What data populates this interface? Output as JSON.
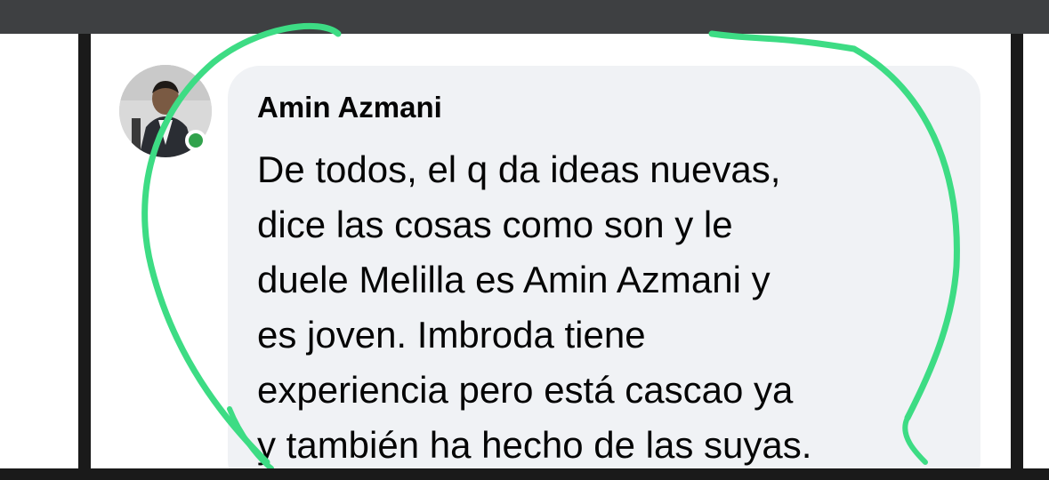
{
  "comment": {
    "author": "Amin Azmani",
    "lines": [
      "De todos, el q da ideas nuevas,",
      "dice las cosas como son y le",
      "duele Melilla es Amin Azmani y",
      "es joven. Imbroda tiene",
      "experiencia pero está cascao ya",
      "y también ha hecho de las suyas."
    ],
    "online": true
  },
  "icons": {
    "avatar": "profile-photo",
    "status": "online-status-dot"
  },
  "colors": {
    "highlight": "#3ddc84",
    "online": "#31a24c",
    "bubble": "#f0f2f5",
    "text": "#050505"
  }
}
